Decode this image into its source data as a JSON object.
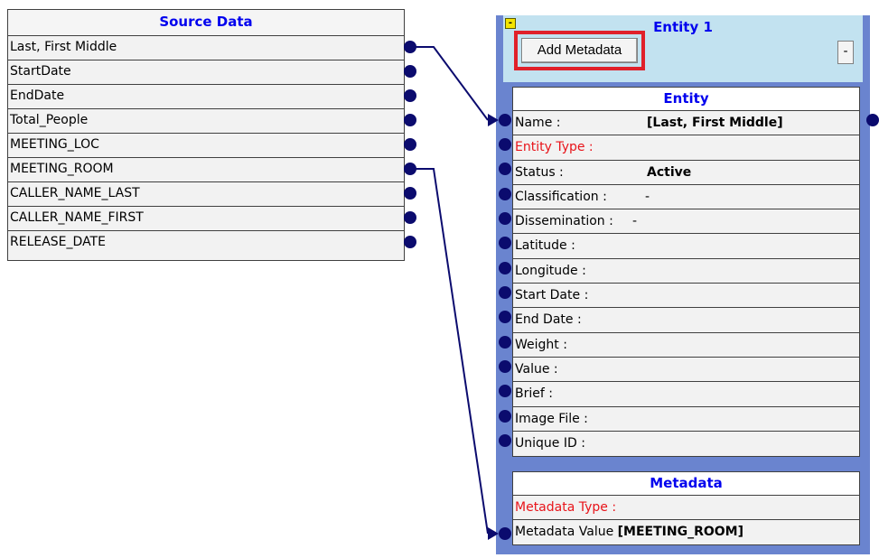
{
  "source": {
    "title": "Source Data",
    "fields": [
      "Last, First Middle",
      "StartDate",
      "EndDate",
      "Total_People",
      "MEETING_LOC",
      "MEETING_ROOM",
      "CALLER_NAME_LAST",
      "CALLER_NAME_FIRST",
      "RELEASE_DATE"
    ]
  },
  "entity": {
    "panel_title": "Entity 1",
    "add_metadata_label": "Add Metadata",
    "minus_label": "-",
    "collapse_label": "-",
    "table_title": "Entity",
    "rows": [
      {
        "label": "Name :",
        "value": "[Last, First Middle]"
      },
      {
        "label": "Entity Type :",
        "value": ""
      },
      {
        "label": "Status :",
        "value": "Active"
      },
      {
        "label": "Classification :",
        "value": "-"
      },
      {
        "label": "Dissemination :",
        "value": "-"
      },
      {
        "label": "Latitude :",
        "value": ""
      },
      {
        "label": "Longitude :",
        "value": ""
      },
      {
        "label": "Start Date :",
        "value": ""
      },
      {
        "label": "End Date :",
        "value": ""
      },
      {
        "label": "Weight :",
        "value": ""
      },
      {
        "label": "Value :",
        "value": ""
      },
      {
        "label": "Brief :",
        "value": ""
      },
      {
        "label": "Image File :",
        "value": ""
      },
      {
        "label": "Unique ID :",
        "value": ""
      }
    ]
  },
  "metadata": {
    "title": "Metadata",
    "type_label": "Metadata Type :",
    "value_label": "Metadata Value",
    "value": "[MEETING_ROOM]"
  },
  "colors": {
    "title_blue": "#0000ee",
    "required_red": "#e8141a",
    "panel_blue": "#6a84cf",
    "panel_light": "#c2e2f0",
    "highlight_red": "#e0202a",
    "connector": "#0b0b6e"
  }
}
